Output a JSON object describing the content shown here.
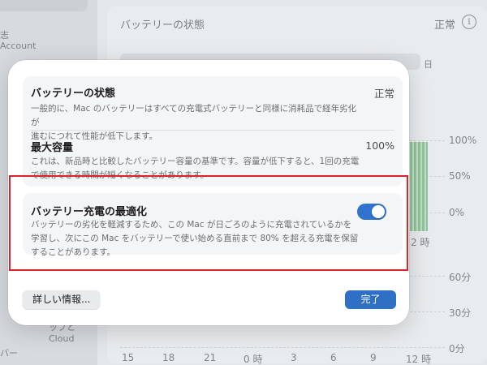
{
  "background": {
    "sidebar": {
      "fragment_1": "志",
      "fragment_2": "Account",
      "fragment_3": "ップとCloud",
      "fragment_4": "バー"
    },
    "header": {
      "title": "バッテリーの状態",
      "status": "正常",
      "info_icon": "info-icon",
      "info_glyph": "i"
    },
    "segment_fragment": "日",
    "chart": {
      "level_ticks": [
        "100%",
        "50%",
        "0%"
      ],
      "usage_ticks": [
        "60分",
        "30分",
        "0分"
      ],
      "x_ticks": [
        "15",
        "18",
        "21",
        "0 時",
        "3",
        "6",
        "9",
        "12 時"
      ],
      "upper_x_fragment": "2 時"
    }
  },
  "sheet": {
    "battery_health": {
      "title": "バッテリーの状態",
      "value": "正常",
      "description_line1": "一般的に、Mac のバッテリーはすべての充電式バッテリーと同様に消耗品で経年劣化が",
      "description_line2": "進むにつれて性能が低下します。"
    },
    "max_capacity": {
      "title": "最大容量",
      "value": "100%",
      "description_line1": "これは、新品時と比較したバッテリー容量の基準です。容量が低下すると、1回の充電",
      "description_line2": "で使用できる時間が短くなることがあります。"
    },
    "optimized_charging": {
      "title": "バッテリー充電の最適化",
      "enabled": true,
      "description_line1": "バッテリーの劣化を軽減するため、この Mac が日ごろのように充電されているかを",
      "description_line2": "学習し、次にこの Mac をバッテリーで使い始める直前まで 80% を超える充電を保留",
      "description_line3": "することがあります。"
    },
    "buttons": {
      "more_info": "詳しい情報...",
      "done": "完了"
    }
  },
  "colors": {
    "accent": "#2f73cf",
    "highlight_box": "#e0202a"
  }
}
